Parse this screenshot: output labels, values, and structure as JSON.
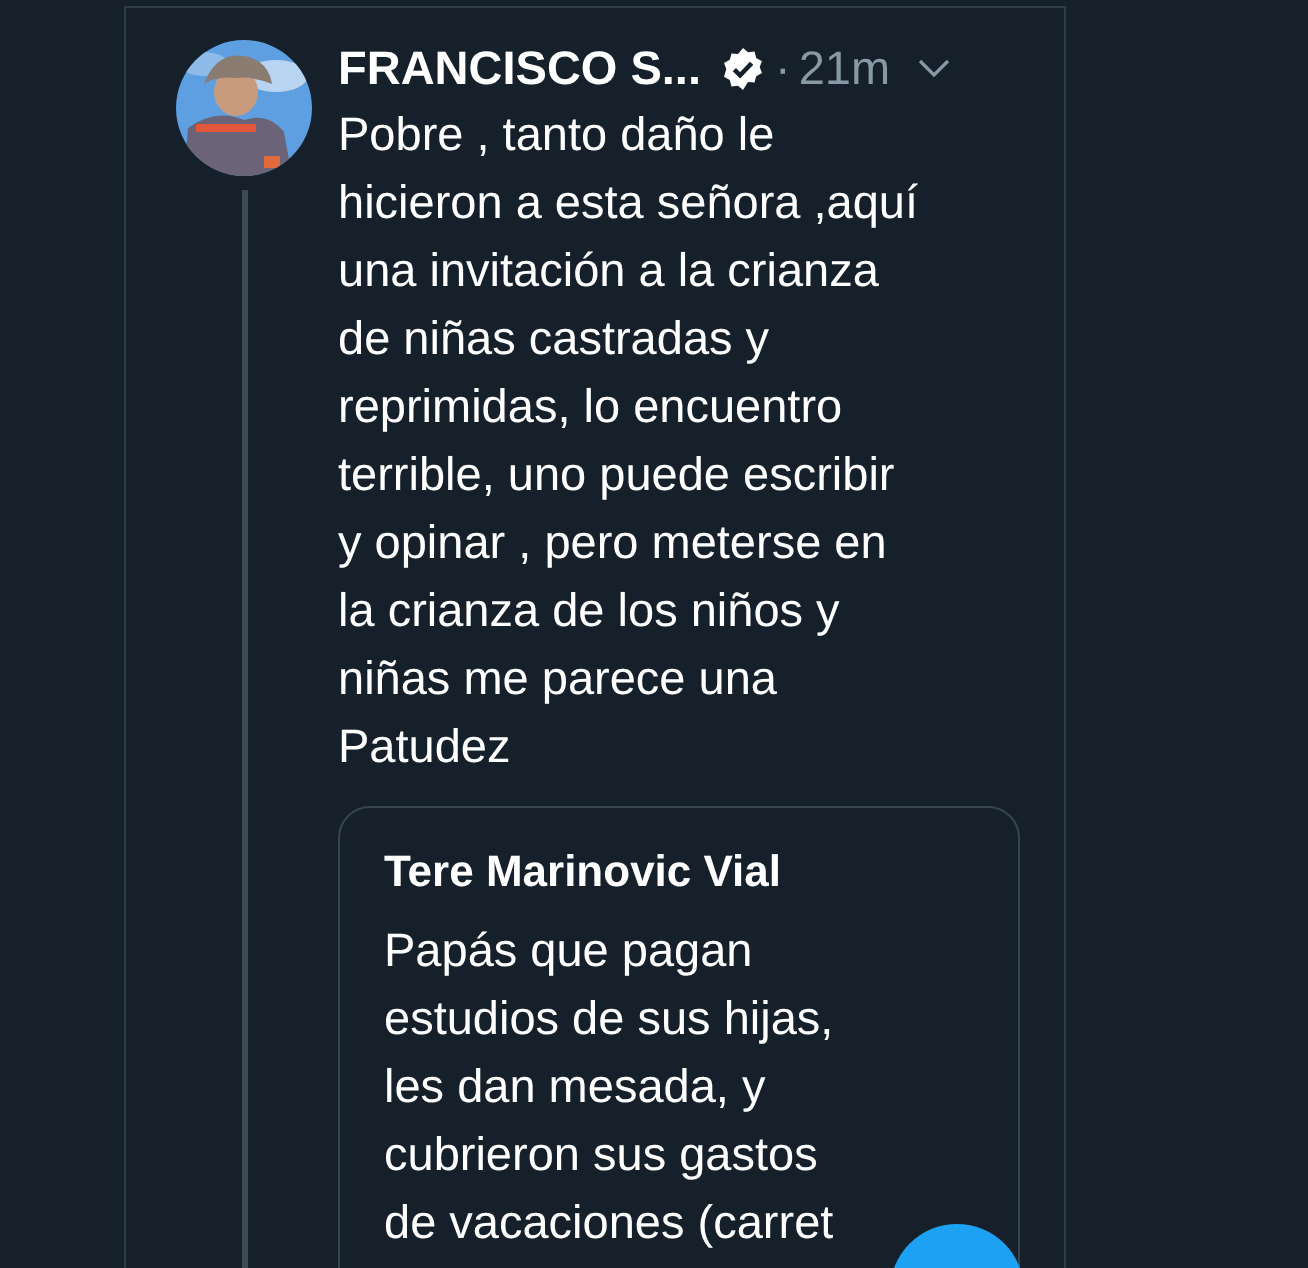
{
  "tweet": {
    "author_name": "FRANCISCO S...",
    "verified": true,
    "separator": "·",
    "time": "21m",
    "text": "Pobre , tanto daño le\nhicieron a esta señora ,aquí\nuna invitación a la crianza\nde niñas castradas y\nreprimidas, lo encuentro\nterrible, uno puede escribir\ny opinar , pero meterse en\nla crianza de los niños y\nniñas me parece una\nPatudez",
    "thread_line": true,
    "quoted_tweet": {
      "author_name": "Tere Marinovic Vial",
      "text": "Papás que pagan\nestudios de sus hijas,\nles dan mesada, y\ncubrieron sus gastos\nde vacaciones (carret"
    }
  }
}
